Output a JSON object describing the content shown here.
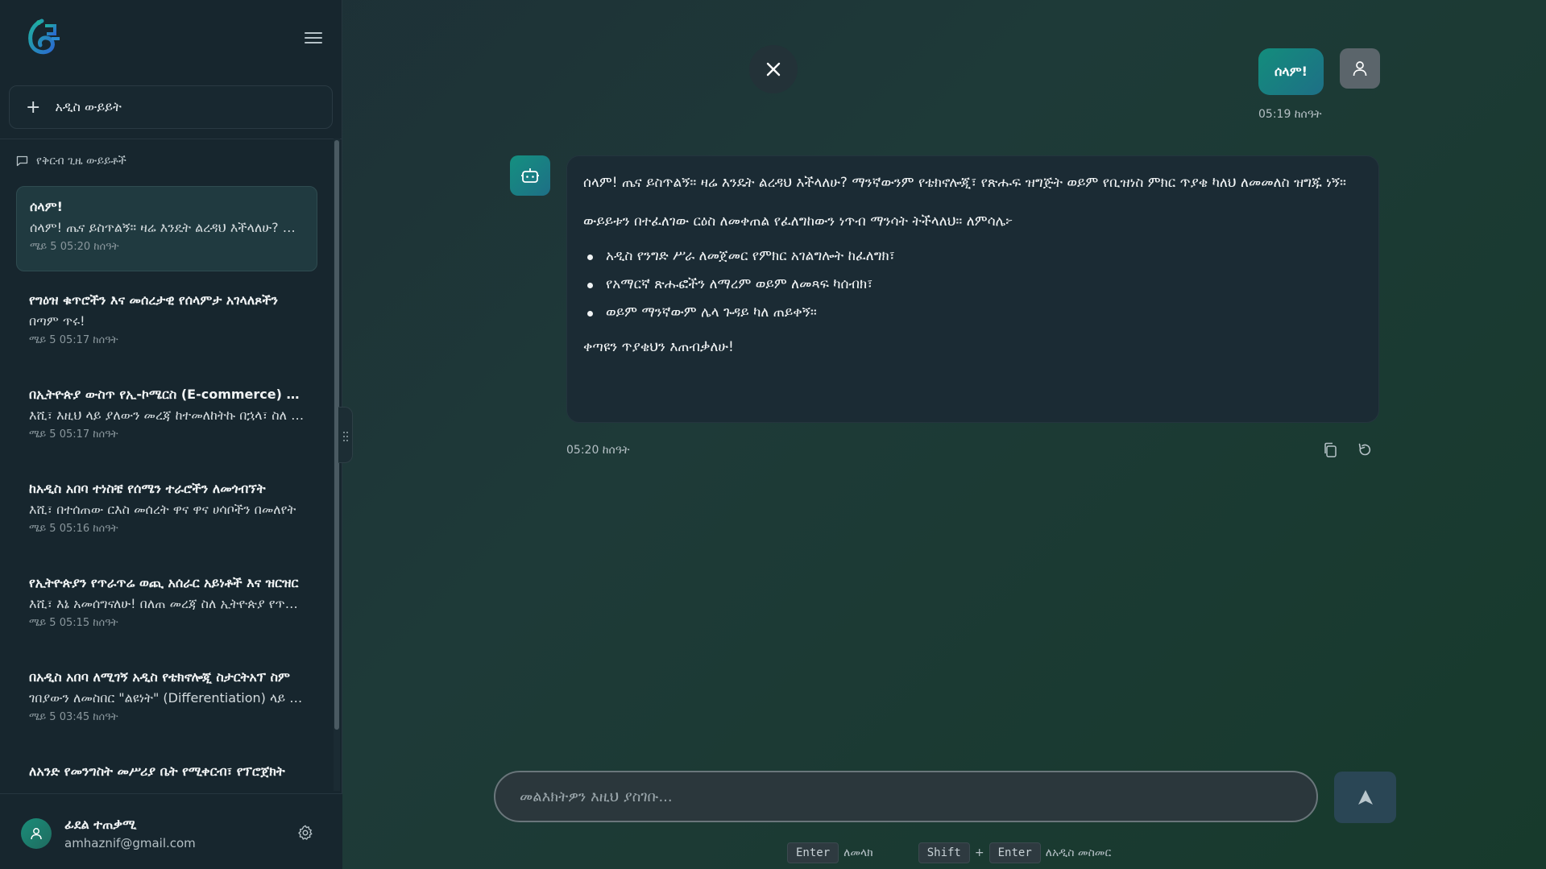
{
  "sidebar": {
    "new_chat_label": "አዲስ ውይይት",
    "recent_heading": "የቅርብ ጊዜ ውይይቶች",
    "conversations": [
      {
        "title": "ሰላም!",
        "preview": "ሰላም! ጤና ይስጥልኝ። ዛሬ እንዴት ልረዳህ እችላለሁ? ማንኛውንም የቴክኖሎጂ፣ የጽሑፍ ዝግጅት",
        "date": "ሜይ 5 05:20 ከሰዓት"
      },
      {
        "title": "የግዕዝ ቁጥሮችን እና መሰረታዊ የሰላምታ አገላለጾችን",
        "preview": "በጣም ጥሩ!",
        "date": "ሜይ 5 05:17 ከሰዓት"
      },
      {
        "title": "በኢትዮጵያ ውስጥ የኢ-ኮሜርስ (E-commerce) ንግድ",
        "preview": "እሺ፣ እዚህ ላይ ያለውን መረጃ ከተመለከትኩ በኋላ፣ ስለ ጉዳዩ",
        "date": "ሜይ 5 05:17 ከሰዓት"
      },
      {
        "title": "ከአዲስ አበባ ተነስቼ የሰሜን ተራሮችን ለመጎብኘት",
        "preview": "እሺ፣ በተሰጠው ርእስ መሰረት ዋና ዋና ሀሳቦችን በመለየት",
        "date": "ሜይ 5 05:16 ከሰዓት"
      },
      {
        "title": "የኢትዮጵያን የጥራጥሬ ወጪ አሰራር አይነቶች እና ዝርዝር",
        "preview": "እሺ፣ እኔ አመሰግናለሁ! በለጠ መረጃ ስለ ኢትዮጵያ የጥራጥሬ",
        "date": "ሜይ 5 05:15 ከሰዓት"
      },
      {
        "title": "በአዲስ አበባ ለሚገኝ አዲስ የቴክኖሎጂ ስታርትአፕ ስም",
        "preview": "ገበያውን ለመስበር \"ልዩነት\" (Differentiation) ላይ ማተኮር",
        "date": "ሜይ 5 03:45 ከሰዓት"
      },
      {
        "title": "ለአንድ የመንግስት መሥሪያ ቤት የሚቀርብ፣ የፕሮጀክት",
        "preview": "",
        "date": ""
      }
    ],
    "user": {
      "name": "ፊደል ተጠቃሚ",
      "email": "amhaznif@gmail.com"
    }
  },
  "chat": {
    "user_message": "ሰላም!",
    "user_time": "05:19 ከሰዓት",
    "bot_intro": "ሰላም! ጤና ይስጥልኝ። ዛሬ እንዴት ልረዳህ እችላለሁ? ማንኛውንም የቴክኖሎጂ፣ የጽሑፍ ዝግጅት ወይም የቢዝነስ ምክር ጥያቄ ካለህ ለመመለስ ዝግጁ ነኝ።",
    "bot_lead": "ውይይቱን በተፈለገው ርዕስ ለመቀጠል የፈለግከውን ነጥብ ማንሳት ትችላለህ። ለምሳሌ፦",
    "bot_bullets": [
      "አዲስ የንግድ ሥራ ለመጀመር የምክር አገልግሎት ከፈለግክ፣",
      "የአማርኛ ጽሑፎችን ለማረም ወይም ለመጻፍ ካሰብክ፣",
      "ወይም ማንኛውም ሌላ ጉዳይ ካለ ጠይቀኝ።"
    ],
    "bot_closing": "ቀጣዩን ጥያቄህን እጠብቃለሁ!",
    "bot_time": "05:20 ከሰዓት"
  },
  "composer": {
    "placeholder": "መልእክትዎን እዚህ ያስገቡ...",
    "hint_enter_key": "Enter",
    "hint_enter_label": "ለመላክ",
    "hint_shift_key": "Shift",
    "hint_plus": "+",
    "hint_enter2_key": "Enter",
    "hint_newline_label": "ለአዲስ መስመር"
  },
  "colors": {
    "accent": "#138d7c",
    "sidebar_bg": "#17262e",
    "bubble_bg": "#1b2b34"
  },
  "icons": [
    "logo-icon",
    "menu-icon",
    "plus-icon",
    "chat-bubble-icon",
    "user-avatar-icon",
    "gear-icon",
    "close-icon",
    "person-icon",
    "bot-icon",
    "copy-icon",
    "refresh-icon",
    "send-icon"
  ]
}
